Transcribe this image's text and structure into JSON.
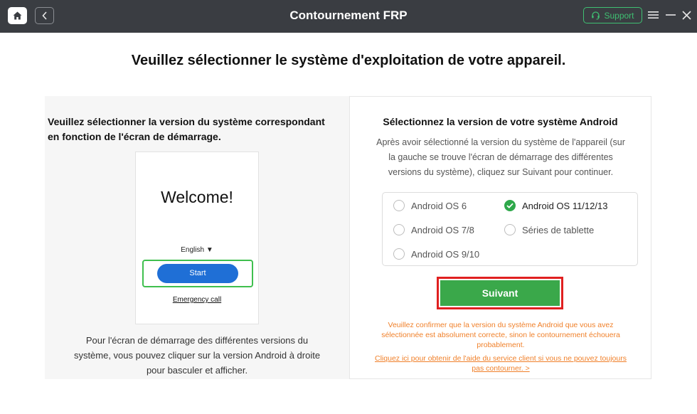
{
  "window": {
    "title": "Contournement FRP",
    "support_label": "Support"
  },
  "page": {
    "heading": "Veuillez sélectionner le système d'exploitation de votre appareil."
  },
  "left_panel": {
    "title_line1": "Veuillez sélectionner la version du système correspondant",
    "title_line2": "en fonction de l'écran de démarrage.",
    "phone": {
      "welcome": "Welcome!",
      "language": "English ▼",
      "start_label": "Start",
      "emergency_label": "Emergency call"
    },
    "note_line1": "Pour l'écran de démarrage des différentes versions du",
    "note_line2": "système, vous pouvez cliquer sur la version Android à droite",
    "note_line3": "pour basculer et afficher."
  },
  "right_panel": {
    "title": "Sélectionnez la version de votre système Android",
    "desc_line1": "Après avoir sélectionné la version du système de l'appareil (sur",
    "desc_line2": "la gauche se trouve l'écran de démarrage des différentes",
    "desc_line3": "versions du système), cliquez sur Suivant pour continuer.",
    "options": [
      {
        "label": "Android OS 6",
        "selected": false
      },
      {
        "label": "Android OS 11/12/13",
        "selected": true
      },
      {
        "label": "Android OS 7/8",
        "selected": false
      },
      {
        "label": "Séries de tablette",
        "selected": false
      },
      {
        "label": "Android OS 9/10",
        "selected": false
      }
    ],
    "next_label": "Suivant",
    "warning_line1": "Veuillez confirmer que la version du système Android que vous avez",
    "warning_line2": "sélectionnée est absolument correcte, sinon le contournement échouera",
    "warning_line3": "probablement.",
    "help_line1": "Cliquez ici pour obtenir de l'aide du service client si vous ne pouvez toujours",
    "help_line2": "pas contourner. >"
  },
  "colors": {
    "titlebar": "#3a3d42",
    "accent_green": "#3aa84a",
    "highlight_red": "#e02020",
    "warning_orange": "#f0802a",
    "start_blue": "#1f6fd6"
  },
  "icons": [
    "home-icon",
    "back-icon",
    "headset-icon",
    "menu-icon",
    "minimize-icon",
    "close-icon",
    "check-icon",
    "dropdown-caret-icon"
  ]
}
